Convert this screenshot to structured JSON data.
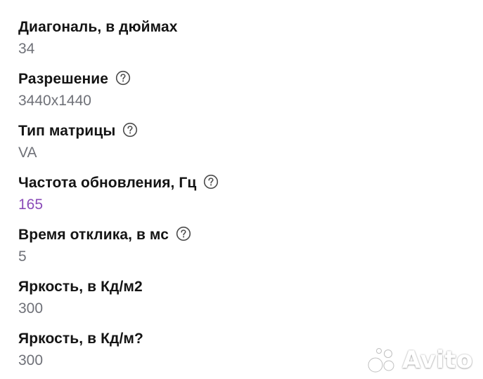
{
  "specs": [
    {
      "label": "Диагональ, в дюймах",
      "value": "34",
      "has_help": false,
      "accent": false
    },
    {
      "label": "Разрешение",
      "value": "3440x1440",
      "has_help": true,
      "accent": false
    },
    {
      "label": "Тип матрицы",
      "value": "VA",
      "has_help": true,
      "accent": false
    },
    {
      "label": "Частота обновления, Гц",
      "value": "165",
      "has_help": true,
      "accent": true
    },
    {
      "label": "Время отклика, в мс",
      "value": "5",
      "has_help": true,
      "accent": false
    },
    {
      "label": "Яркость, в Кд/м2",
      "value": "300",
      "has_help": false,
      "accent": false
    },
    {
      "label": "Яркость, в Кд/м?",
      "value": "300",
      "has_help": false,
      "accent": false
    }
  ],
  "icons": {
    "help": "question-circle-icon"
  },
  "colors": {
    "label": "#141414",
    "value": "#6f7178",
    "accent_value": "#8a4bb8",
    "icon": "#4a4a4a"
  },
  "watermark": {
    "text": "Avito"
  }
}
